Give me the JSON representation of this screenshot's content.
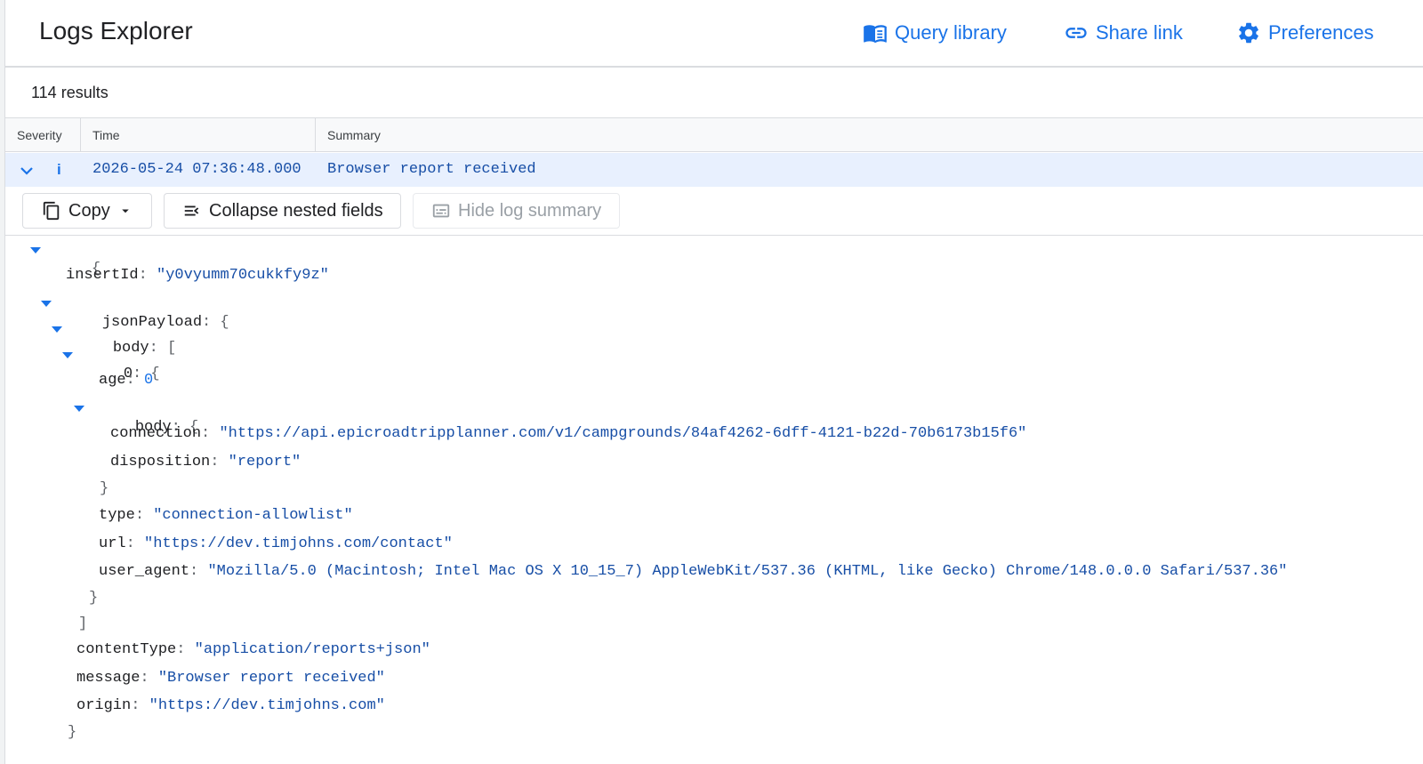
{
  "app": {
    "title": "Logs Explorer"
  },
  "header": {
    "query_library": {
      "label": "Query library",
      "icon": "book-icon"
    },
    "share_link": {
      "label": "Share link",
      "icon": "link-icon"
    },
    "preferences": {
      "label": "Preferences",
      "icon": "gear-icon"
    }
  },
  "results": {
    "count_text": "114 results"
  },
  "columns": {
    "severity": "Severity",
    "time": "Time",
    "summary": "Summary"
  },
  "log_row": {
    "severity_glyph": "i",
    "time": "2026-05-24 07:36:48.000",
    "summary": "Browser report received"
  },
  "actions": {
    "copy": "Copy",
    "collapse": "Collapse nested fields",
    "hide_summary": "Hide log summary"
  },
  "tree": {
    "open_brace": "{",
    "insertId_key": "insertId",
    "insertId_val": "\"y0vyumm70cukkfy9z\"",
    "jsonPayload_key": "jsonPayload",
    "body_key": "body",
    "item0_key": "0",
    "age_key": "age",
    "age_val": "0",
    "inner_body_key": "body",
    "connection_key": "connection",
    "connection_val": "\"https://api.epicroadtripplanner.com/v1/campgrounds/84af4262-6dff-4121-b22d-70b6173b15f6\"",
    "disposition_key": "disposition",
    "disposition_val": "\"report\"",
    "type_key": "type",
    "type_val": "\"connection-allowlist\"",
    "url_key": "url",
    "url_val": "\"https://dev.timjohns.com/contact\"",
    "user_agent_key": "user_agent",
    "user_agent_val": "\"Mozilla/5.0 (Macintosh; Intel Mac OS X 10_15_7) AppleWebKit/537.36 (KHTML, like Gecko) Chrome/148.0.0.0 Safari/537.36\"",
    "contentType_key": "contentType",
    "contentType_val": "\"application/reports+json\"",
    "message_key": "message",
    "message_val": "\"Browser report received\"",
    "origin_key": "origin",
    "origin_val": "\"https://dev.timjohns.com\""
  }
}
